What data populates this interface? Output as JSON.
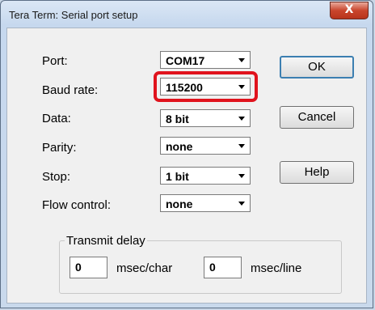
{
  "window": {
    "title": "Tera Term: Serial port setup",
    "close_glyph": "X"
  },
  "fields": {
    "port": {
      "label": "Port:",
      "value": "COM17"
    },
    "baud_rate": {
      "label": "Baud rate:",
      "value": "115200"
    },
    "data": {
      "label": "Data:",
      "value": "8 bit"
    },
    "parity": {
      "label": "Parity:",
      "value": "none"
    },
    "stop": {
      "label": "Stop:",
      "value": "1 bit"
    },
    "flow_control": {
      "label": "Flow control:",
      "value": "none"
    }
  },
  "buttons": {
    "ok": "OK",
    "cancel": "Cancel",
    "help": "Help"
  },
  "transmit_delay": {
    "title": "Transmit delay",
    "char_value": "0",
    "char_unit": "msec/char",
    "line_value": "0",
    "line_unit": "msec/line"
  },
  "colors": {
    "highlight": "#e0131d",
    "close_button": "#c9452c",
    "default_button_border": "#3c7fb1"
  }
}
